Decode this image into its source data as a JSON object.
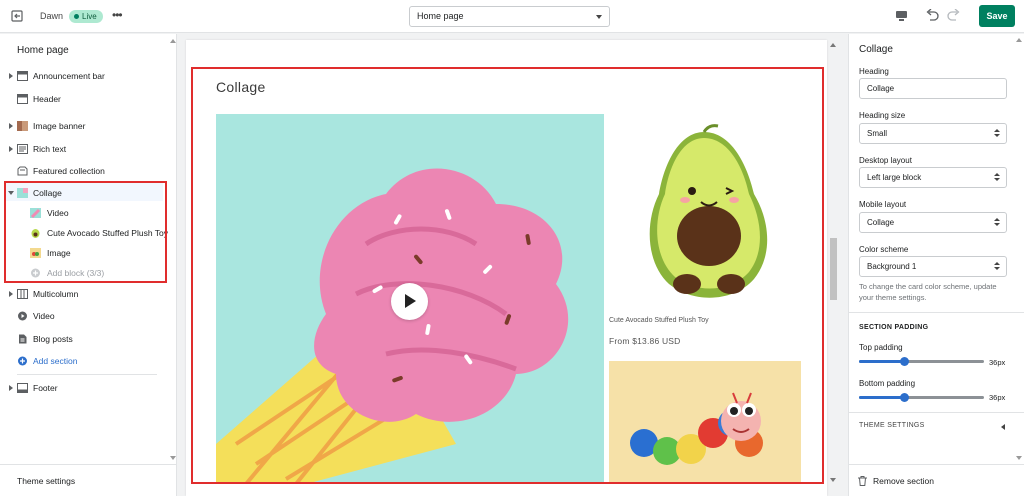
{
  "topbar": {
    "theme_name": "Dawn",
    "status_badge": "Live",
    "page_selector": "Home page",
    "save_label": "Save",
    "save_color": "#008060"
  },
  "left_sidebar": {
    "title": "Home page",
    "sections": [
      {
        "label": "Announcement bar",
        "icon": "announcement-bar-icon",
        "expandable": true
      },
      {
        "label": "Header",
        "icon": "header-icon",
        "expandable": false
      },
      {
        "label": "Image banner",
        "icon": "image-banner-icon",
        "expandable": true
      },
      {
        "label": "Rich text",
        "icon": "rich-text-icon",
        "expandable": true
      },
      {
        "label": "Featured collection",
        "icon": "featured-collection-icon",
        "expandable": false
      },
      {
        "label": "Collage",
        "icon": "collage-icon",
        "expandable": true,
        "expanded": true,
        "selected": true
      },
      {
        "label": "Multicolumn",
        "icon": "multicolumn-icon",
        "expandable": true
      },
      {
        "label": "Video",
        "icon": "video-icon",
        "expandable": false
      },
      {
        "label": "Blog posts",
        "icon": "blog-posts-icon",
        "expandable": false
      }
    ],
    "collage_blocks": [
      {
        "label": "Video",
        "icon": "video-thumbnail"
      },
      {
        "label": "Cute Avocado Stuffed Plush Toy",
        "icon": "avocado-thumbnail"
      },
      {
        "label": "Image",
        "icon": "image-thumbnail"
      }
    ],
    "add_block": "Add block (3/3)",
    "add_section": "Add section",
    "footer_section": "Footer",
    "theme_settings": "Theme settings"
  },
  "preview": {
    "collage_heading": "Collage",
    "product_title": "Cute Avocado Stuffed Plush Toy",
    "product_price": "From $13.86 USD"
  },
  "right_panel": {
    "title": "Collage",
    "heading_label": "Heading",
    "heading_value": "Collage",
    "heading_size_label": "Heading size",
    "heading_size_value": "Small",
    "desktop_layout_label": "Desktop layout",
    "desktop_layout_value": "Left large block",
    "mobile_layout_label": "Mobile layout",
    "mobile_layout_value": "Collage",
    "color_scheme_label": "Color scheme",
    "color_scheme_value": "Background 1",
    "color_scheme_help": "To change the card color scheme, update your theme settings.",
    "section_padding": "SECTION PADDING",
    "top_padding_label": "Top padding",
    "top_padding_value": "36px",
    "top_padding_fraction": 0.36,
    "bottom_padding_label": "Bottom padding",
    "bottom_padding_value": "36px",
    "bottom_padding_fraction": 0.36,
    "theme_settings": "THEME SETTINGS",
    "remove_section": "Remove section"
  }
}
